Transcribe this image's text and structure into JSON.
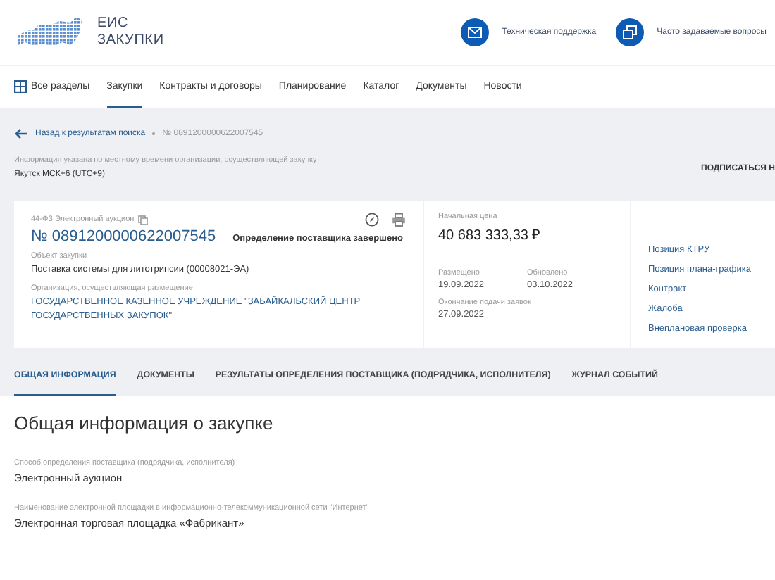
{
  "header": {
    "logo_lines": [
      "ЕИС",
      "ЗАКУПКИ"
    ],
    "links": [
      {
        "label": "Техническая поддержка",
        "kind": "mail"
      },
      {
        "label": "Часто задаваемые вопросы",
        "kind": "windows"
      }
    ]
  },
  "nav": {
    "items": [
      {
        "label": "Все разделы",
        "kind": "sections",
        "selected": false
      },
      {
        "label": "Закупки",
        "kind": "link",
        "selected": true
      },
      {
        "label": "Контракты и договоры",
        "kind": "link",
        "selected": false
      },
      {
        "label": "Планирование",
        "kind": "link",
        "selected": false
      },
      {
        "label": "Каталог",
        "kind": "link",
        "selected": false
      },
      {
        "label": "Документы",
        "kind": "link",
        "selected": false
      },
      {
        "label": "Новости",
        "kind": "link",
        "selected": false
      }
    ]
  },
  "breadcrumb": {
    "back": "Назад к результатам поиска",
    "current": "№ 0891200000622007545"
  },
  "timezone": {
    "note": "Информация указана по местному времени организации, осуществляющей закупку",
    "value": "Якутск МСК+6 (UTC+9)"
  },
  "subscribe": "ПОДПИСАТЬСЯ Н",
  "card": {
    "type": "44-ФЗ Электронный аукцион",
    "number": "№ 0891200000622007545",
    "status": "Определение поставщика завершено",
    "fields": [
      {
        "label": "Объект закупки",
        "value": "Поставка системы для литотрипсии (00008021-ЭА)",
        "kind": "text"
      },
      {
        "label": "Организация, осуществляющая размещение",
        "value": "ГОСУДАРСТВЕННОЕ КАЗЕННОЕ УЧРЕЖДЕНИЕ \"ЗАБАЙКАЛЬСКИЙ ЦЕНТР ГОСУДАРСТВЕННЫХ ЗАКУПОК\"",
        "kind": "link"
      }
    ],
    "price": {
      "label": "Начальная цена",
      "value": "40 683 333,33 ₽"
    },
    "dates": [
      {
        "label": "Размещено",
        "value": "19.09.2022"
      },
      {
        "label": "Обновлено",
        "value": "03.10.2022"
      },
      {
        "label": "Окончание подачи заявок",
        "value": "27.09.2022"
      }
    ],
    "links": [
      "Позиция КТРУ",
      "Позиция плана-графика",
      "Контракт",
      "Жалоба",
      "Внеплановая проверка"
    ]
  },
  "tabs": [
    {
      "label": "ОБЩАЯ ИНФОРМАЦИЯ",
      "selected": true
    },
    {
      "label": "ДОКУМЕНТЫ",
      "selected": false
    },
    {
      "label": "РЕЗУЛЬТАТЫ ОПРЕДЕЛЕНИЯ ПОСТАВЩИКА (ПОДРЯДЧИКА, ИСПОЛНИТЕЛЯ)",
      "selected": false
    },
    {
      "label": "ЖУРНАЛ СОБЫТИЙ",
      "selected": false
    }
  ],
  "section": {
    "title": "Общая информация о закупке",
    "fields": [
      {
        "label": "Способ определения поставщика (подрядчика, исполнителя)",
        "value": "Электронный аукцион"
      },
      {
        "label": "Наименование электронной площадки в информационно-телекоммуникационной сети \"Интернет\"",
        "value": "Электронная торговая площадка «Фабрикант»"
      }
    ]
  }
}
